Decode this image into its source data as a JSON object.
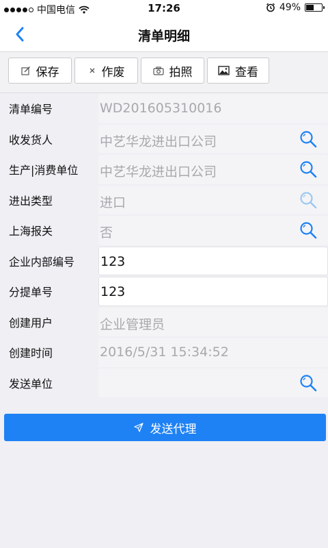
{
  "status_bar": {
    "carrier": "中国电信",
    "time": "17:26",
    "battery_percent": "49%",
    "battery_level": 0.49,
    "signal_bars_filled": 4,
    "icons": [
      "wifi-icon",
      "alarm-icon",
      "battery-icon"
    ]
  },
  "nav": {
    "title": "清单明细",
    "back_icon": "chevron-left-icon",
    "accent_color": "#1e82f5"
  },
  "toolbar": {
    "save_label": "保存",
    "void_label": "作废",
    "photo_label": "拍照",
    "view_label": "查看"
  },
  "form": {
    "rows": [
      {
        "label": "清单编号",
        "value": "WD201605310016",
        "editable": false,
        "has_search": false
      },
      {
        "label": "收发货人",
        "value": "中艺华龙进出口公司",
        "editable": false,
        "has_search": true
      },
      {
        "label": "生产|消费单位",
        "value": "中艺华龙进出口公司",
        "editable": false,
        "has_search": true
      },
      {
        "label": "进出类型",
        "value": "进口",
        "editable": false,
        "has_search": true,
        "search_disabled": true
      },
      {
        "label": "上海报关",
        "value": "否",
        "editable": false,
        "has_search": true
      },
      {
        "label": "企业内部编号",
        "value": "123",
        "editable": true,
        "has_search": false
      },
      {
        "label": "分提单号",
        "value": "123",
        "editable": true,
        "has_search": false
      },
      {
        "label": "创建用户",
        "value": "企业管理员",
        "editable": false,
        "has_search": false
      },
      {
        "label": "创建时间",
        "value": "2016/5/31 15:34:52",
        "editable": false,
        "has_search": false
      },
      {
        "label": "发送单位",
        "value": "",
        "editable": false,
        "has_search": true
      }
    ]
  },
  "send_button": {
    "label": "发送代理",
    "icon": "send-icon",
    "color": "#1e82f5"
  }
}
